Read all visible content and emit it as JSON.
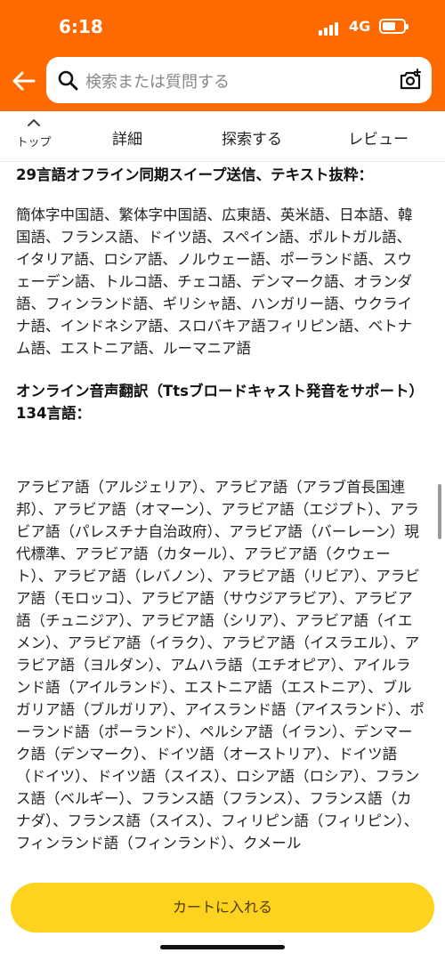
{
  "status_bar": {
    "time": "6:18",
    "network": "4G"
  },
  "search": {
    "placeholder": "検索または質問する"
  },
  "tabs": {
    "top_label": "トップ",
    "items": [
      "詳細",
      "探索する",
      "レビュー"
    ]
  },
  "content": {
    "heading1": "29言語オフライン同期スイープ送信、テキスト抜粋：",
    "paragraph1": "簡体字中国語、繁体字中国語、広東語、英米語、日本語、韓国語、フランス語、ドイツ語、スペイン語、ポルトガル語、イタリア語、ロシア語、ノルウェー語、ポーランド語、スウェーデン語、トルコ語、チェコ語、デンマーク語、オランダ語、フィンランド語、ギリシャ語、ハンガリー語、ウクライナ語、インドネシア語、スロバキア語フィリピン語、ベトナム語、エストニア語、ルーマニア語",
    "heading2": "オンライン音声翻訳（Ttsブロードキャスト発音をサポート）134言語：",
    "paragraph2": "アラビア語（アルジェリア）、アラビア語（アラブ首長国連邦）、アラビア語（オマーン）、アラビア語（エジプト）、アラビア語（パレスチナ自治政府）、アラビア語（バーレーン）現代標準、アラビア語（カタール）、アラビア語（クウェート）、アラビア語（レバノン）、アラビア語（リビア）、アラビア語（モロッコ）、アラビア語（サウジアラビア）、アラビア語（チュニジア）、アラビア語（シリア）、アラビア語（イエメン）、アラビア語（イラク）、アラビア語（イスラエル）、アラビア語（ヨルダン）、アムハラ語（エチオピア）、アイルランド語（アイルランド）、エストニア語（エストニア）、ブルガリア語（ブルガリア）、アイスランド語（アイスランド）、ポーランド語（ポーランド）、ペルシア語（イラン）、デンマーク語（デンマーク）、ドイツ語（オーストリア）、ドイツ語（ドイツ）、ドイツ語（スイス）、ロシア語（ロシア）、フランス語（ベルギー）、フランス語（フランス）、フランス語（カナダ）、フランス語（スイス）、フィリピン語（フィリピン）、フィンランド語（フィンランド）、クメール"
  },
  "bottom": {
    "cart_label": "カートに入れる"
  }
}
